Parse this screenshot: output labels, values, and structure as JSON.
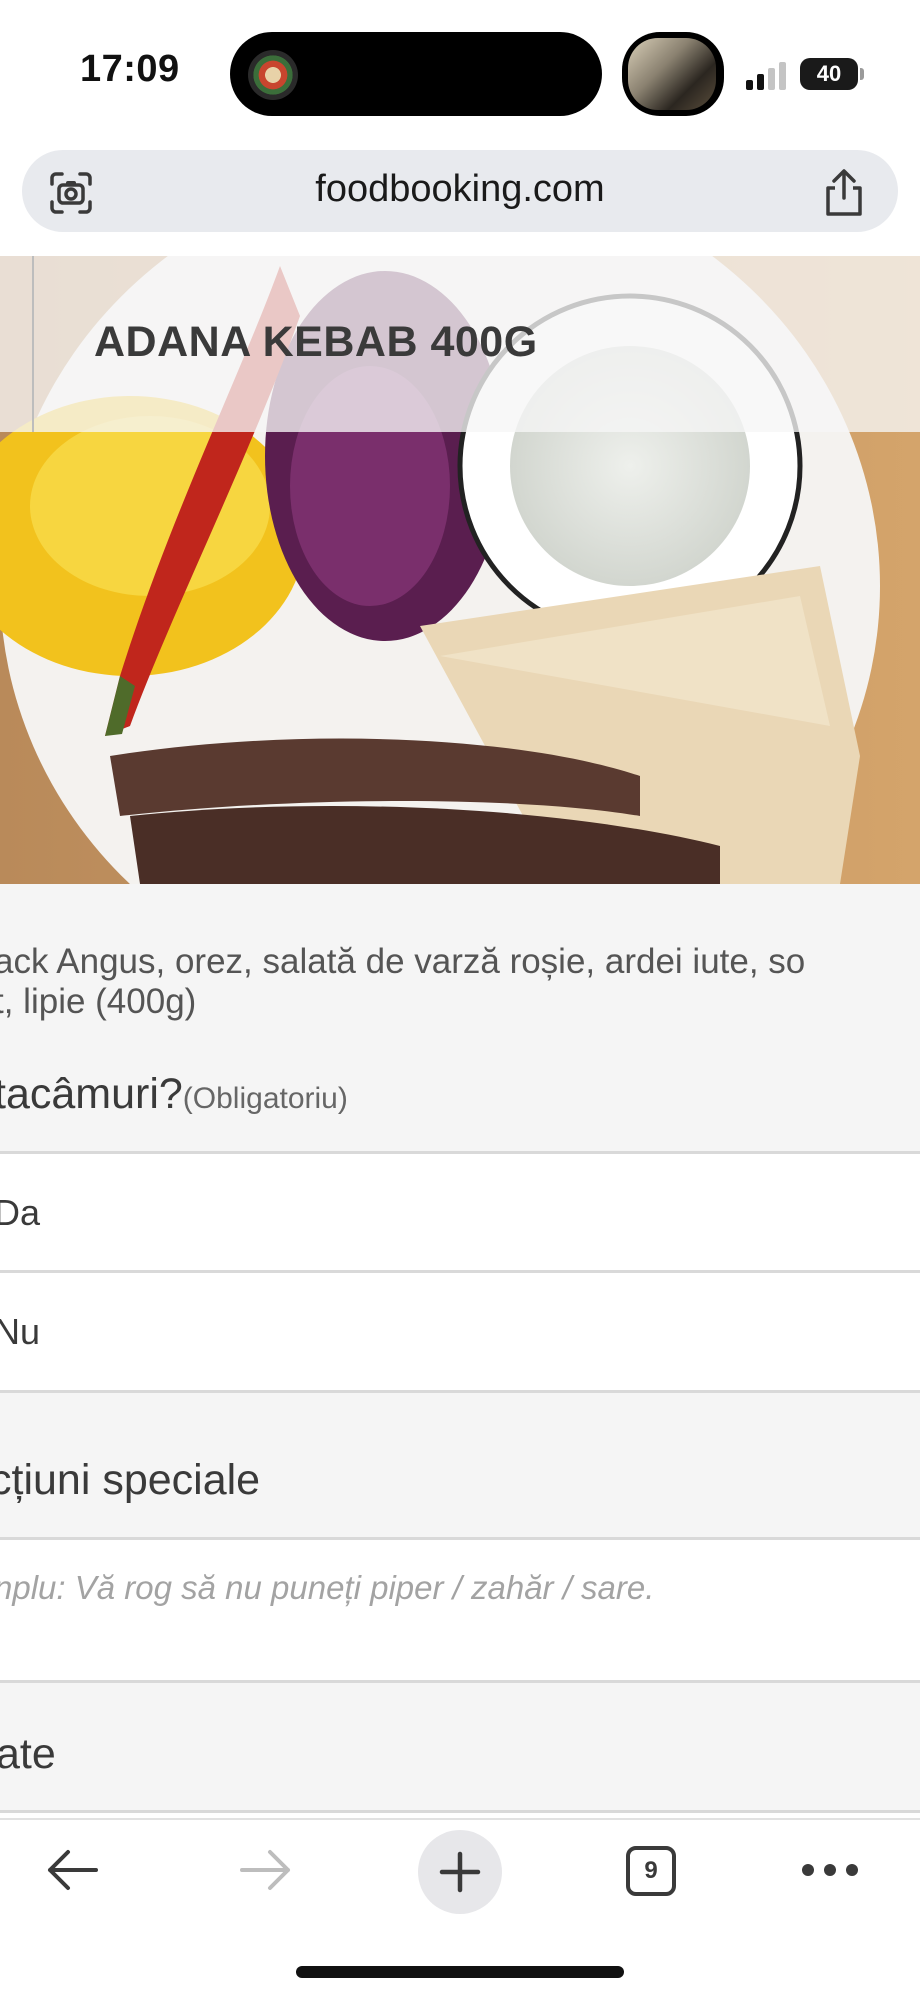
{
  "status_bar": {
    "time": "17:09",
    "battery": "40"
  },
  "browser": {
    "url": "foodbooking.com",
    "tab_count": "9"
  },
  "dish": {
    "title": "ADANA KEBAB 400G",
    "description_line1": "ack Angus, orez, salată de varză roșie, ardei iute, so",
    "description_line2": "t, lipie (400g)"
  },
  "cutlery": {
    "question": "tacâmuri?",
    "required_label": "(Obligatoriu)",
    "options": [
      "Da",
      "Nu"
    ]
  },
  "special_instructions": {
    "title": "cțiuni speciale",
    "placeholder": "nplu: Vă rog să nu puneți piper / zahăr / sare."
  },
  "quantity": {
    "title": "ate"
  },
  "icons": {
    "lens": "lens-icon",
    "share": "share-icon",
    "back": "back-arrow-icon",
    "forward": "forward-arrow-icon",
    "new_tab": "plus-icon",
    "tabs": "tabs-icon",
    "more": "more-icon"
  },
  "colors": {
    "accent_gray": "#e7e7ea",
    "text_dark": "#3a3a3a",
    "placeholder": "#a3a3a3"
  }
}
